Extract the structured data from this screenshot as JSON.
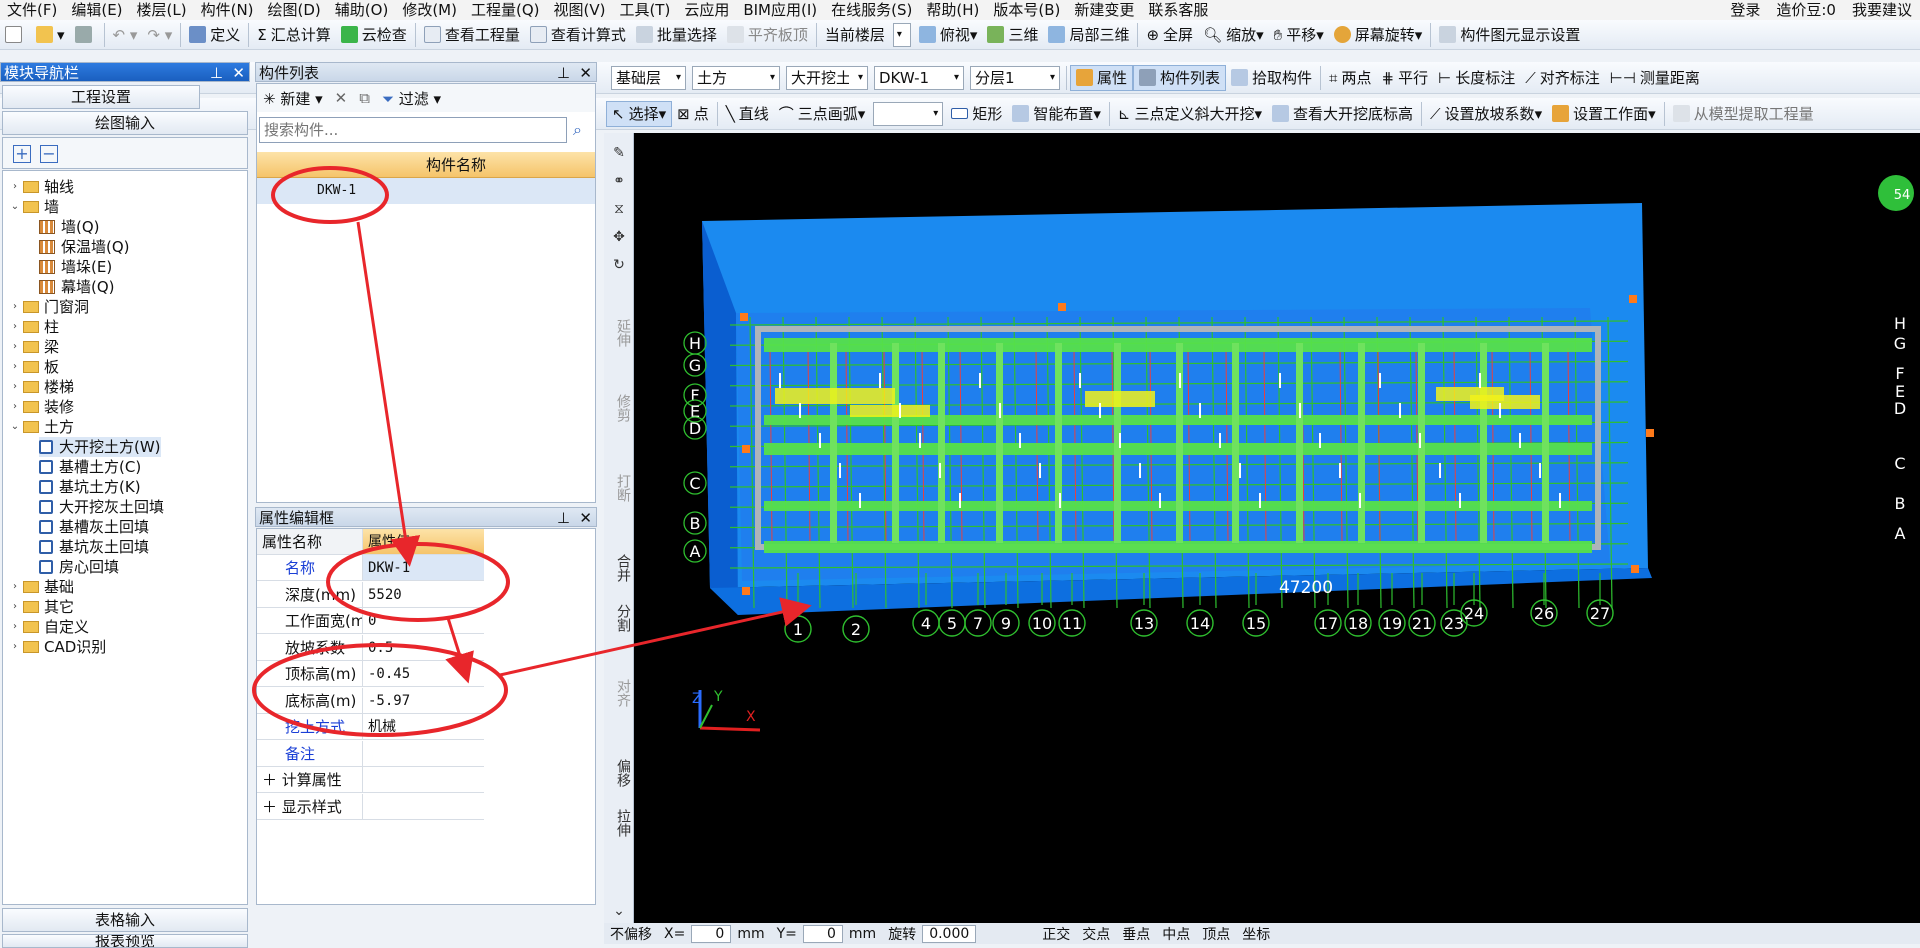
{
  "menu": [
    "文件(F)",
    "编辑(E)",
    "楼层(L)",
    "构件(N)",
    "绘图(D)",
    "辅助(O)",
    "修改(M)",
    "工程量(Q)",
    "视图(V)",
    "工具(T)",
    "云应用",
    "BIM应用(I)",
    "在线服务(S)",
    "帮助(H)",
    "版本号(B)",
    "新建变更",
    "联系客服"
  ],
  "menu_right": {
    "login": "登录",
    "beans": "造价豆:0",
    "suggest": "我要建议"
  },
  "toolbar1": [
    "定义",
    "汇总计算",
    "云检查",
    "查看工程量",
    "查看计算式",
    "批量选择",
    "平齐板顶",
    "当前楼层",
    "俯视",
    "三维",
    "局部三维",
    "全屏",
    "缩放",
    "平移",
    "屏幕旋转",
    "构件图元显示设置"
  ],
  "toolbar2": {
    "combos": [
      "基础层",
      "土方",
      "大开挖土方",
      "DKW-1",
      "分层1"
    ],
    "buttons": [
      "属性",
      "构件列表",
      "拾取构件",
      "两点",
      "平行",
      "长度标注",
      "对齐标注",
      "测量距离"
    ]
  },
  "toolbar3": [
    "选择",
    "点",
    "直线",
    "三点画弧",
    "矩形",
    "智能布置",
    "三点定义斜大开挖",
    "查看大开挖底标高",
    "设置放坡系数",
    "设置工作面",
    "从模型提取工程量"
  ],
  "nav": {
    "title": "模块导航栏",
    "btn_project": "工程设置",
    "btn_draw": "绘图输入",
    "btn_table": "表格输入",
    "btn_report": "报表预览",
    "tree": [
      {
        "label": "轴线",
        "level": 0,
        "exp": "›",
        "kind": "folder"
      },
      {
        "label": "墙",
        "level": 0,
        "exp": "⌄",
        "kind": "folder"
      },
      {
        "label": "墙(Q)",
        "level": 1,
        "kind": "wall"
      },
      {
        "label": "保温墙(Q)",
        "level": 1,
        "kind": "wall"
      },
      {
        "label": "墙垛(E)",
        "level": 1,
        "kind": "wall"
      },
      {
        "label": "幕墙(Q)",
        "level": 1,
        "kind": "wall"
      },
      {
        "label": "门窗洞",
        "level": 0,
        "exp": "›",
        "kind": "folder"
      },
      {
        "label": "柱",
        "level": 0,
        "exp": "›",
        "kind": "folder"
      },
      {
        "label": "梁",
        "level": 0,
        "exp": "›",
        "kind": "folder"
      },
      {
        "label": "板",
        "level": 0,
        "exp": "›",
        "kind": "folder"
      },
      {
        "label": "楼梯",
        "level": 0,
        "exp": "›",
        "kind": "folder"
      },
      {
        "label": "装修",
        "level": 0,
        "exp": "›",
        "kind": "folder"
      },
      {
        "label": "土方",
        "level": 0,
        "exp": "⌄",
        "kind": "folder"
      },
      {
        "label": "大开挖土方(W)",
        "level": 1,
        "kind": "comp",
        "selected": true
      },
      {
        "label": "基槽土方(C)",
        "level": 1,
        "kind": "comp"
      },
      {
        "label": "基坑土方(K)",
        "level": 1,
        "kind": "comp"
      },
      {
        "label": "大开挖灰土回填",
        "level": 1,
        "kind": "comp"
      },
      {
        "label": "基槽灰土回填",
        "level": 1,
        "kind": "comp"
      },
      {
        "label": "基坑灰土回填",
        "level": 1,
        "kind": "comp"
      },
      {
        "label": "房心回填",
        "level": 1,
        "kind": "comp"
      },
      {
        "label": "基础",
        "level": 0,
        "exp": "›",
        "kind": "folder"
      },
      {
        "label": "其它",
        "level": 0,
        "exp": "›",
        "kind": "folder"
      },
      {
        "label": "自定义",
        "level": 0,
        "exp": "›",
        "kind": "folder"
      },
      {
        "label": "CAD识别",
        "level": 0,
        "exp": "›",
        "kind": "folder"
      }
    ]
  },
  "complist": {
    "title": "构件列表",
    "new_label": "新建",
    "filter_label": "过滤",
    "search_placeholder": "搜索构件...",
    "column": "构件名称",
    "rows": [
      "DKW-1"
    ]
  },
  "props": {
    "title": "属性编辑框",
    "col_name": "属性名称",
    "col_value": "属性值",
    "rows": [
      {
        "k": "名称",
        "v": "DKW-1",
        "blue": true
      },
      {
        "k": "深度(mm)",
        "v": "5520"
      },
      {
        "k": "工作面宽(mm)",
        "v": "0"
      },
      {
        "k": "放坡系数",
        "v": "0.5"
      },
      {
        "k": "顶标高(m)",
        "v": "-0.45"
      },
      {
        "k": "底标高(m)",
        "v": "-5.97"
      },
      {
        "k": "挖土方式",
        "v": "机械",
        "blue": true
      },
      {
        "k": "备注",
        "v": "",
        "blue": true
      },
      {
        "k": "计算属性",
        "v": "",
        "group": true
      },
      {
        "k": "显示样式",
        "v": "",
        "group": true
      }
    ]
  },
  "vtools": [
    "延伸",
    "修剪",
    "打断",
    "合并",
    "分割",
    "对齐",
    "偏移",
    "拉伸"
  ],
  "viewport": {
    "dimension": "47200",
    "axis_bottom": [
      "1",
      "2",
      "4",
      "5",
      "7",
      "9",
      "10",
      "11",
      "13",
      "14",
      "15",
      "17",
      "18",
      "19",
      "21",
      "23",
      "24",
      "26",
      "27"
    ],
    "axis_left": [
      "H",
      "G",
      "F",
      "E",
      "D",
      "C",
      "B",
      "A"
    ],
    "axis_right": [
      "H",
      "G",
      "F",
      "E",
      "D",
      "C",
      "B",
      "A"
    ],
    "badge": "54",
    "axes_labels": {
      "x": "X",
      "y": "Y",
      "z": "Z"
    }
  },
  "status": [
    "不偏移",
    "X=",
    "0",
    "mm",
    "Y=",
    "0",
    "mm",
    "旋转",
    "0.000",
    "正交",
    "交点",
    "垂点",
    "中点",
    "顶点",
    "坐标"
  ],
  "colors": {
    "pit": "#1b8af0",
    "pit_side": "#0a5ed0",
    "grid_green": "#2fbf2f",
    "beam_green": "#56e04a",
    "annot_red": "#e8262b"
  }
}
